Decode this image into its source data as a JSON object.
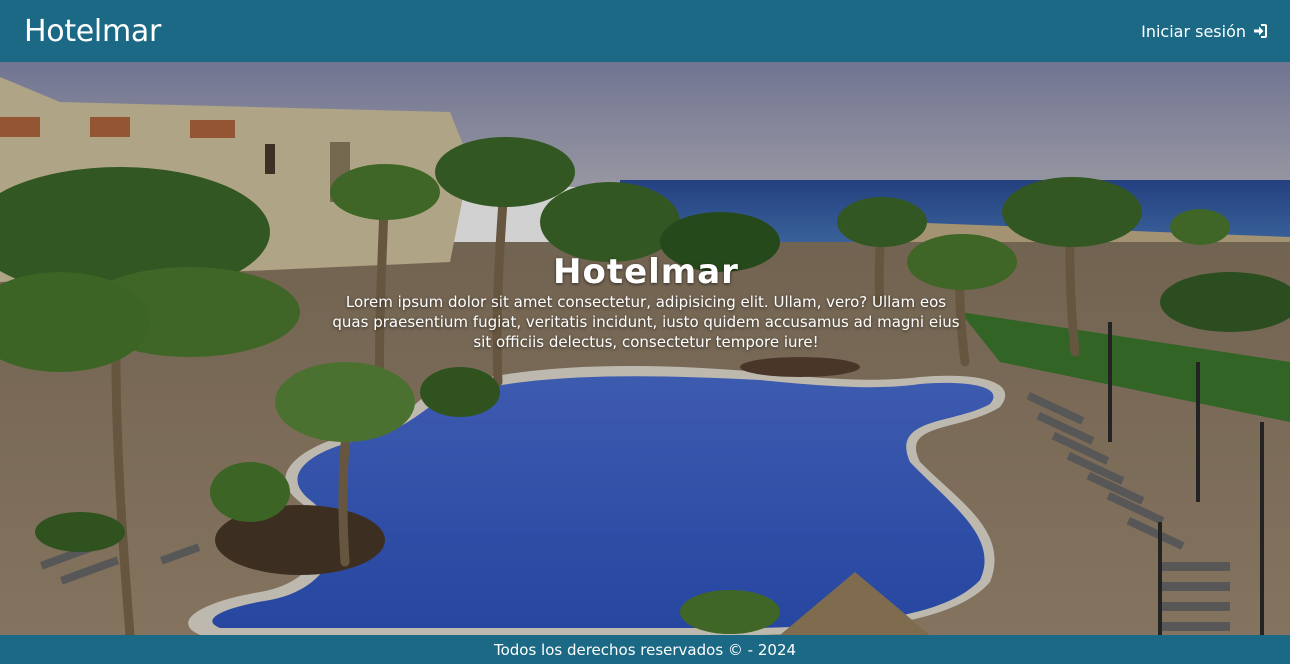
{
  "navbar": {
    "brand": "Hotelmar",
    "login_label": "Iniciar sesión",
    "login_icon": "sign-in-icon",
    "background": "#1b6985"
  },
  "hero": {
    "title": "Hotelmar",
    "description": "Lorem ipsum dolor sit amet consectetur, adipisicing elit. Ullam, vero? Ullam eos quas praesentium fugiat, veritatis incidunt, iusto quidem accusamus ad magni eius sit officiis delectus, consectetur tempore iure!",
    "image": "resort-pool-with-palm-trees"
  },
  "footer": {
    "text": "Todos los derechos reservados © - 2024"
  }
}
